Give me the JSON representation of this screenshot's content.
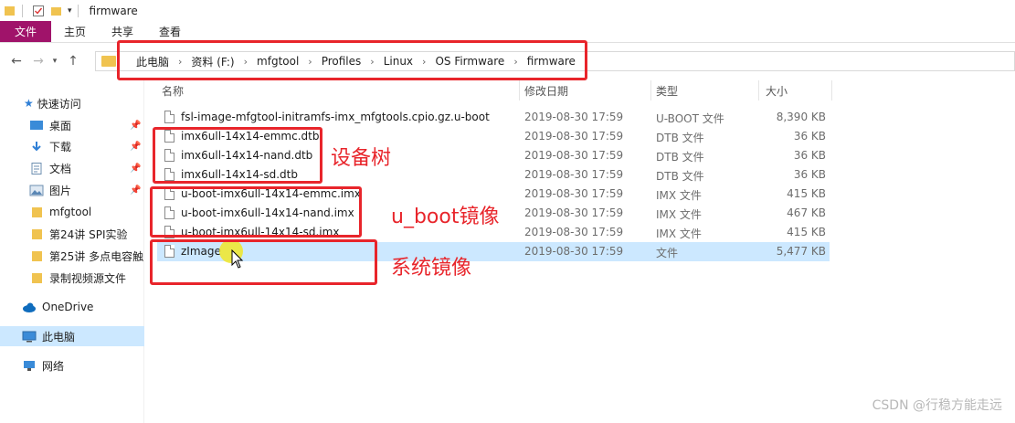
{
  "window": {
    "title": "firmware"
  },
  "ribbon": {
    "tabs": [
      "文件",
      "主页",
      "共享",
      "查看"
    ]
  },
  "address": {
    "crumbs": [
      "此电脑",
      "资料 (F:)",
      "mfgtool",
      "Profiles",
      "Linux",
      "OS Firmware",
      "firmware"
    ]
  },
  "sidebar": {
    "quick_access": "快速访问",
    "items": [
      "桌面",
      "下载",
      "文档",
      "图片",
      "mfgtool",
      "第24讲 SPI实验",
      "第25讲 多点电容触",
      "录制视频源文件"
    ],
    "onedrive": "OneDrive",
    "this_pc": "此电脑",
    "network": "网络"
  },
  "columns": {
    "name": "名称",
    "date": "修改日期",
    "type": "类型",
    "size": "大小"
  },
  "files": [
    {
      "name": "fsl-image-mfgtool-initramfs-imx_mfgtools.cpio.gz.u-boot",
      "date": "2019-08-30 17:59",
      "type": "U-BOOT 文件",
      "size": "8,390 KB"
    },
    {
      "name": "imx6ull-14x14-emmc.dtb",
      "date": "2019-08-30 17:59",
      "type": "DTB 文件",
      "size": "36 KB"
    },
    {
      "name": "imx6ull-14x14-nand.dtb",
      "date": "2019-08-30 17:59",
      "type": "DTB 文件",
      "size": "36 KB"
    },
    {
      "name": "imx6ull-14x14-sd.dtb",
      "date": "2019-08-30 17:59",
      "type": "DTB 文件",
      "size": "36 KB"
    },
    {
      "name": "u-boot-imx6ull-14x14-emmc.imx",
      "date": "2019-08-30 17:59",
      "type": "IMX 文件",
      "size": "415 KB"
    },
    {
      "name": "u-boot-imx6ull-14x14-nand.imx",
      "date": "2019-08-30 17:59",
      "type": "IMX 文件",
      "size": "467 KB"
    },
    {
      "name": "u-boot-imx6ull-14x14-sd.imx",
      "date": "2019-08-30 17:59",
      "type": "IMX 文件",
      "size": "415 KB"
    },
    {
      "name": "zImage",
      "date": "2019-08-30 17:59",
      "type": "文件",
      "size": "5,477 KB"
    }
  ],
  "annotations": {
    "dtb": "设备树",
    "uboot": "u_boot镜像",
    "system": "系统镜像"
  },
  "watermark": "CSDN @行稳方能走远",
  "colors": {
    "file_tab": "#a0136a",
    "annotation": "#e8252b",
    "selection": "#cce8ff",
    "folder": "#f0c350"
  }
}
